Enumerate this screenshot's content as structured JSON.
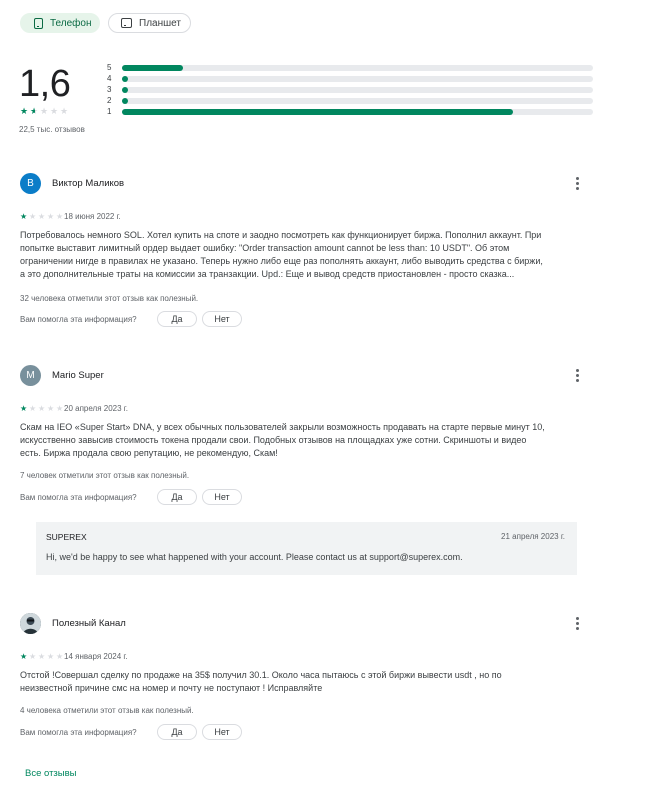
{
  "device_tabs": [
    {
      "label": "Телефон",
      "selected": true
    },
    {
      "label": "Планшет",
      "selected": false
    }
  ],
  "summary": {
    "rating": "1,6",
    "stars_value": 1.6,
    "review_count": "22,5 тыс. отзывов",
    "histogram": [
      {
        "label": "5",
        "fraction": 0.13
      },
      {
        "label": "4",
        "fraction": 0.01
      },
      {
        "label": "3",
        "fraction": 0.01
      },
      {
        "label": "2",
        "fraction": 0.01
      },
      {
        "label": "1",
        "fraction": 0.83
      }
    ]
  },
  "reviews": [
    {
      "avatar_letter": "В",
      "avatar_color": "#0b7dc8",
      "author": "Виктор Маликов",
      "stars": 1,
      "date": "18 июня 2022 г.",
      "text_lines": [
        "Потребовалось немного SOL. Хотел купить на споте и заодно посмотреть как функционирует биржа. Пополнил аккаунт. При",
        "попытке выставит лимитный ордер выдает ошибку: \"Order transaction amount cannot be less than: 10 USDT\". Об этом",
        "ограничении нигде в правилах не указано. Теперь нужно либо еще раз пополнять аккаунт, либо выводить средства с биржи,",
        "а это дополнительные траты на комиссии за транзакции. Upd.: Еще и вывод средств приостановлен - просто сказка..."
      ],
      "helpful": "32 человека отметили этот отзыв как полезный.",
      "question": "Вам помогла эта информация?",
      "yes": "Да",
      "no": "Нет"
    },
    {
      "avatar_letter": "M",
      "avatar_color": "#78909c",
      "author": "Mario Super",
      "stars": 1,
      "date": "20 апреля 2023 г.",
      "text_lines": [
        "Скам на IEO «Super Start» DNA, у всех обычных пользователей закрыли возможность продавать на старте первые минут 10,",
        "искусственно завысив стоимость токена продали свои. Подобных отзывов на площадках уже сотни. Скриншоты и видео",
        "есть. Биржа продала свою репутацию, не рекомендую, Скам!"
      ],
      "helpful": "7 человек отметили этот отзыв как полезный.",
      "question": "Вам помогла эта информация?",
      "yes": "Да",
      "no": "Нет",
      "developer_reply": {
        "name": "SUPEREX",
        "date": "21 апреля 2023 г.",
        "text": "Hi, we'd be happy to see what happened with your account. Please contact us at support@superex.com."
      }
    },
    {
      "avatar_letter": "",
      "avatar_color": "#3c4a55",
      "author": "Полезный Канал",
      "stars": 1,
      "date": "14 января 2024 г.",
      "text_lines": [
        "Отстой !Совершал сделку по продаже на 35$ получил 30.1. Около часа пытаюсь с этой биржи вывести usdt , но по",
        "неизвестной причине смс на номер и почту не поступают ! Исправляйте"
      ],
      "helpful": "4 человека отметили этот отзыв как полезный.",
      "question": "Вам помогла эта информация?",
      "yes": "Да",
      "no": "Нет"
    }
  ],
  "footer": {
    "all_reviews": "Все отзывы"
  }
}
